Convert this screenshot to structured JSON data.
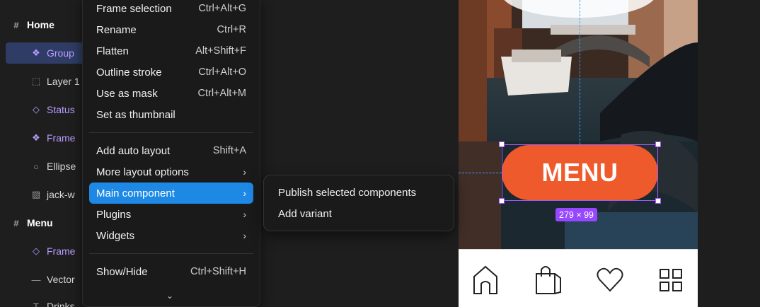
{
  "layers": [
    {
      "label": "Home",
      "type": "board"
    },
    {
      "label": "Group",
      "type": "component",
      "selected": true
    },
    {
      "label": "Layer 1",
      "type": "frame"
    },
    {
      "label": "Status",
      "type": "component-instance"
    },
    {
      "label": "Frame",
      "type": "component"
    },
    {
      "label": "Ellipse",
      "type": "ellipse"
    },
    {
      "label": "jack-w",
      "type": "image"
    },
    {
      "label": "Menu",
      "type": "board"
    },
    {
      "label": "Frame",
      "type": "component-instance"
    },
    {
      "label": "Vector",
      "type": "path"
    },
    {
      "label": "Drinks",
      "type": "text"
    }
  ],
  "context_menu": {
    "items": [
      {
        "label": "Frame selection",
        "shortcut": "Ctrl+Alt+G"
      },
      {
        "label": "Rename",
        "shortcut": "Ctrl+R"
      },
      {
        "label": "Flatten",
        "shortcut": "Alt+Shift+F"
      },
      {
        "label": "Outline stroke",
        "shortcut": "Ctrl+Alt+O"
      },
      {
        "label": "Use as mask",
        "shortcut": "Ctrl+Alt+M"
      },
      {
        "label": "Set as thumbnail",
        "shortcut": ""
      },
      {
        "label": "Add auto layout",
        "shortcut": "Shift+A"
      },
      {
        "label": "More layout options",
        "shortcut": "›"
      },
      {
        "label": "Main component",
        "shortcut": "›",
        "highlighted": true
      },
      {
        "label": "Plugins",
        "shortcut": "›"
      },
      {
        "label": "Widgets",
        "shortcut": "›"
      },
      {
        "label": "Show/Hide",
        "shortcut": "Ctrl+Shift+H"
      }
    ],
    "more_indicator": "⌄"
  },
  "submenu": {
    "items": [
      "Publish selected components",
      "Add variant"
    ]
  },
  "canvas": {
    "menu_button_label": "MENU",
    "selection_dimensions": "279 × 99",
    "accent_color": "#9747ff",
    "button_color": "#ee5a2c",
    "tabbar_icons": [
      "home-icon",
      "shopping-bag-icon",
      "heart-icon",
      "grid-icon"
    ]
  }
}
